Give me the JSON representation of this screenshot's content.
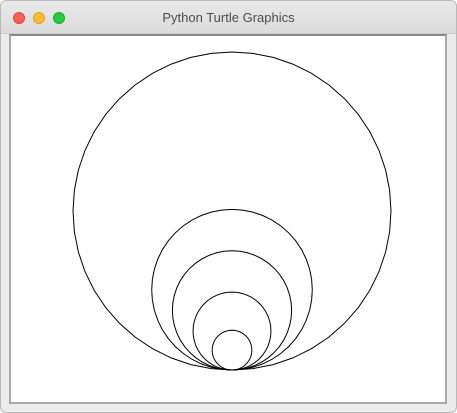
{
  "window": {
    "title": "Python Turtle Graphics"
  },
  "controls": {
    "close_icon": "close-icon",
    "minimize_icon": "minimize-icon",
    "zoom_icon": "zoom-icon"
  },
  "canvas": {
    "background": "#ffffff",
    "stroke_color": "#000000",
    "shape": "circle",
    "count": 5,
    "description_relative_radii": [
      1.0,
      0.505,
      0.375,
      0.245,
      0.125
    ]
  }
}
